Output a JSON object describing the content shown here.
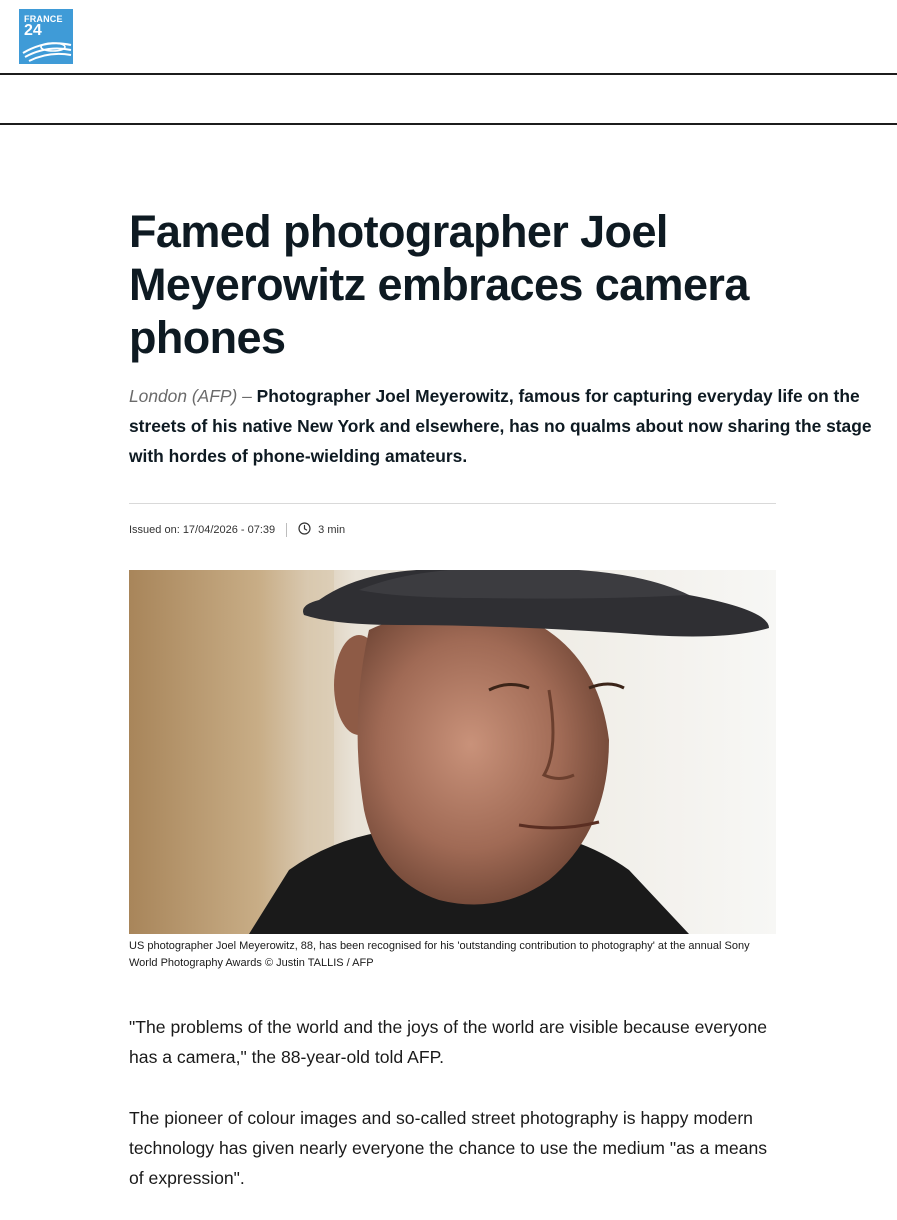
{
  "header": {
    "logo_line1": "FRANCE",
    "logo_line2": "24"
  },
  "article": {
    "title": "Famed photographer Joel Meyerowitz embraces camera phones",
    "dateline": "London (AFP) –",
    "lede": "Photographer Joel Meyerowitz, famous for capturing everyday life on the streets of his native New York and elsewhere, has no qualms about now sharing the stage with hordes of phone-wielding amateurs.",
    "issued": "Issued on: 17/04/2026 - 07:39",
    "read_time": "3 min",
    "caption": "US photographer Joel Meyerowitz, 88, has been recognised for his 'outstanding contribution to photography' at the annual Sony World Photography Awards",
    "credit": "© Justin TALLIS / AFP",
    "paragraphs": [
      "\"The problems of the world and the joys of the world are visible because everyone has a camera,\" the 88-year-old told AFP.",
      "The pioneer of colour images and so-called street photography is happy modern technology has given nearly everyone the chance to use the medium \"as a means of expression\"."
    ]
  },
  "colors": {
    "brand": "#3f9bd7",
    "text": "#0e1a22"
  }
}
